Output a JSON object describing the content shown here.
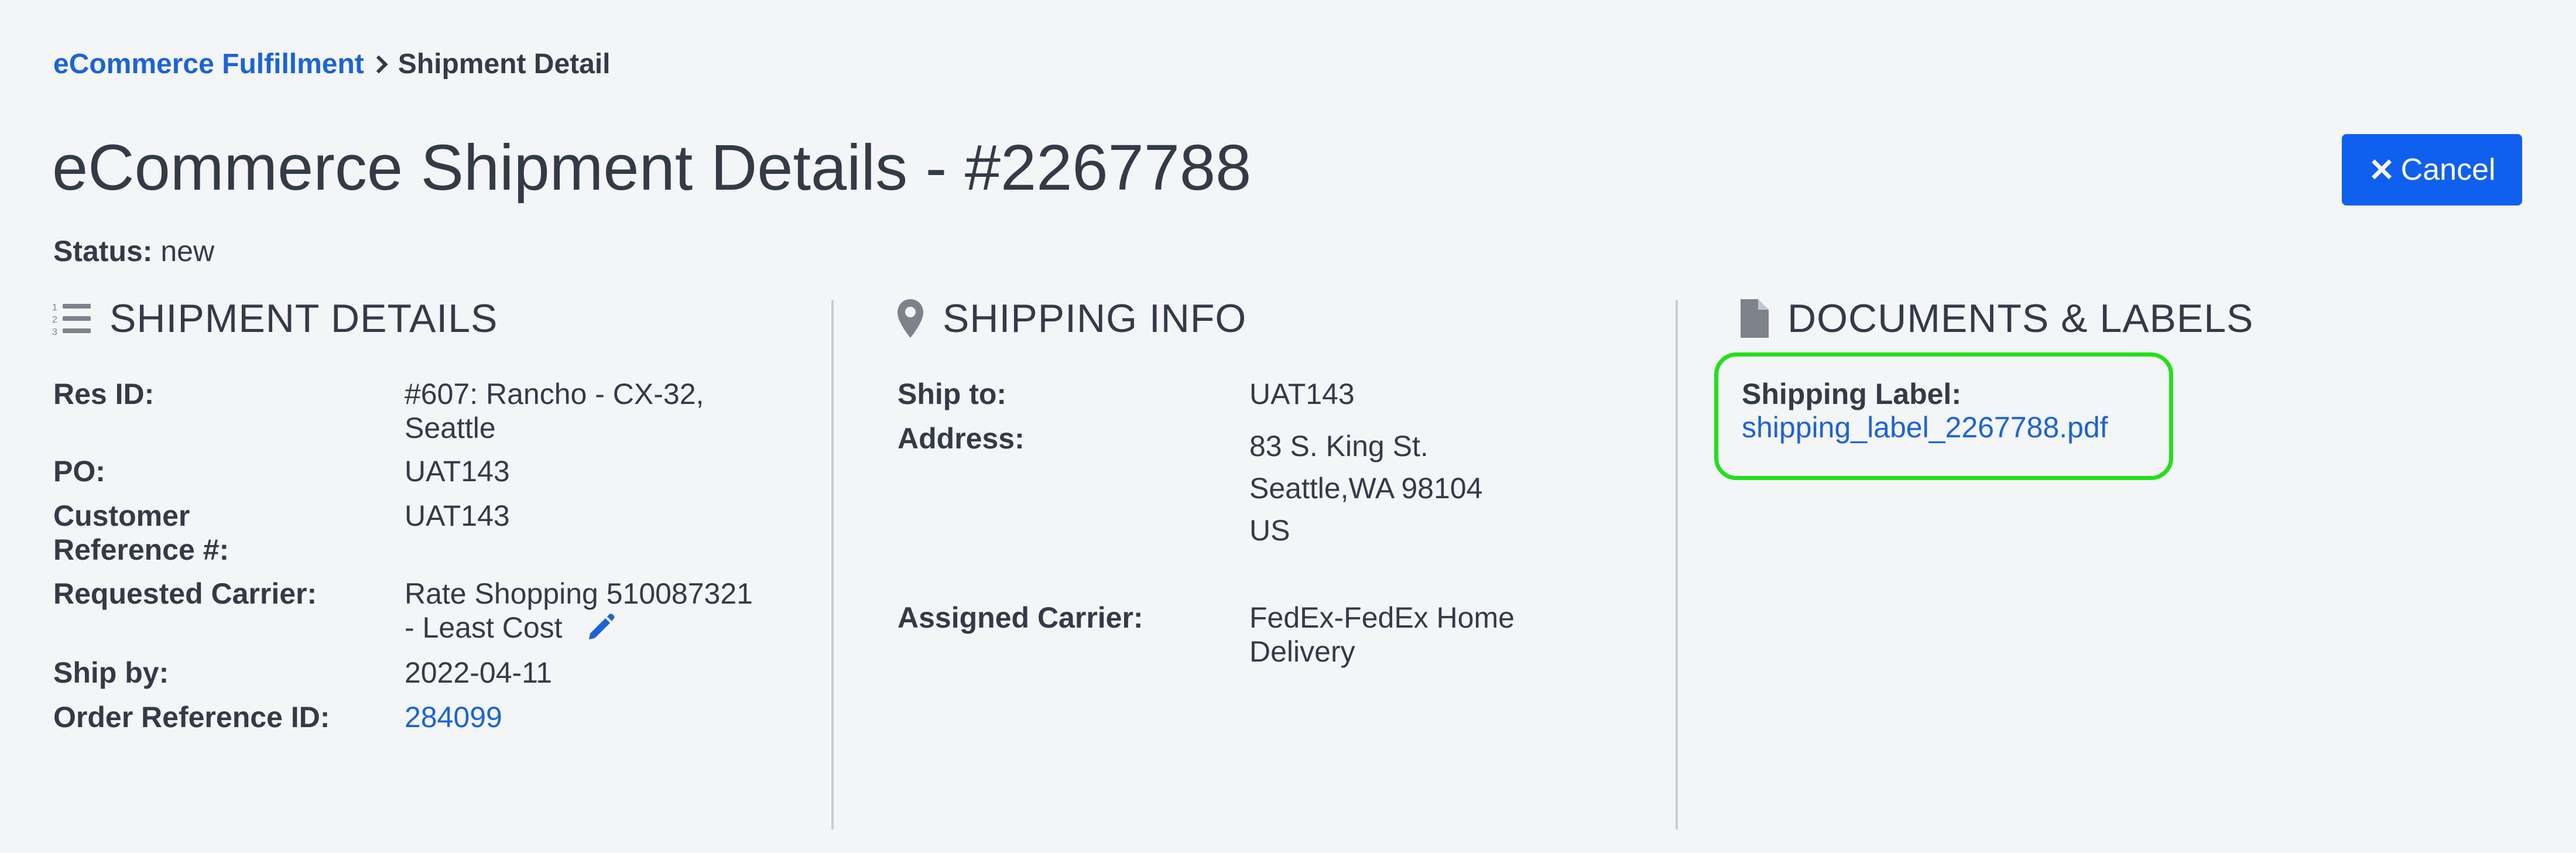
{
  "breadcrumb": {
    "parent": "eCommerce Fulfillment",
    "current": "Shipment Detail"
  },
  "title": "eCommerce Shipment Details - #2267788",
  "cancel_label": "Cancel",
  "status": {
    "label": "Status:",
    "value": "new"
  },
  "shipment_details": {
    "heading": "SHIPMENT DETAILS",
    "res_id": {
      "label": "Res ID:",
      "value_line1": "#607: Rancho - CX-32,",
      "value_line2": "Seattle"
    },
    "po": {
      "label": "PO:",
      "value": "UAT143"
    },
    "customer_ref": {
      "label_line1": "Customer",
      "label_line2": "Reference #:",
      "value": "UAT143"
    },
    "requested_carrier": {
      "label": "Requested Carrier:",
      "value_line1": "Rate Shopping 510087321",
      "value_line2": "- Least Cost"
    },
    "ship_by": {
      "label": "Ship by:",
      "value": "2022-04-11"
    },
    "order_ref": {
      "label": "Order Reference ID:",
      "value": "284099"
    }
  },
  "shipping_info": {
    "heading": "SHIPPING INFO",
    "ship_to": {
      "label": "Ship to:",
      "value": "UAT143"
    },
    "address": {
      "label": "Address:",
      "line1": "83 S. King St.",
      "line2": "Seattle,WA 98104",
      "line3": "US"
    },
    "assigned_carrier": {
      "label": "Assigned Carrier:",
      "value_line1": "FedEx-FedEx Home",
      "value_line2": "Delivery"
    }
  },
  "documents": {
    "heading": "DOCUMENTS & LABELS",
    "shipping_label": {
      "label": "Shipping Label:",
      "file": "shipping_label_2267788.pdf"
    }
  },
  "colors": {
    "accent": "#1060f0",
    "link": "#1a63d8",
    "highlight": "#22e01a",
    "text": "#343a46"
  },
  "icons": [
    "list-ol-icon",
    "map-marker-icon",
    "file-icon",
    "pencil-icon",
    "times-icon",
    "chevron-right-icon"
  ]
}
